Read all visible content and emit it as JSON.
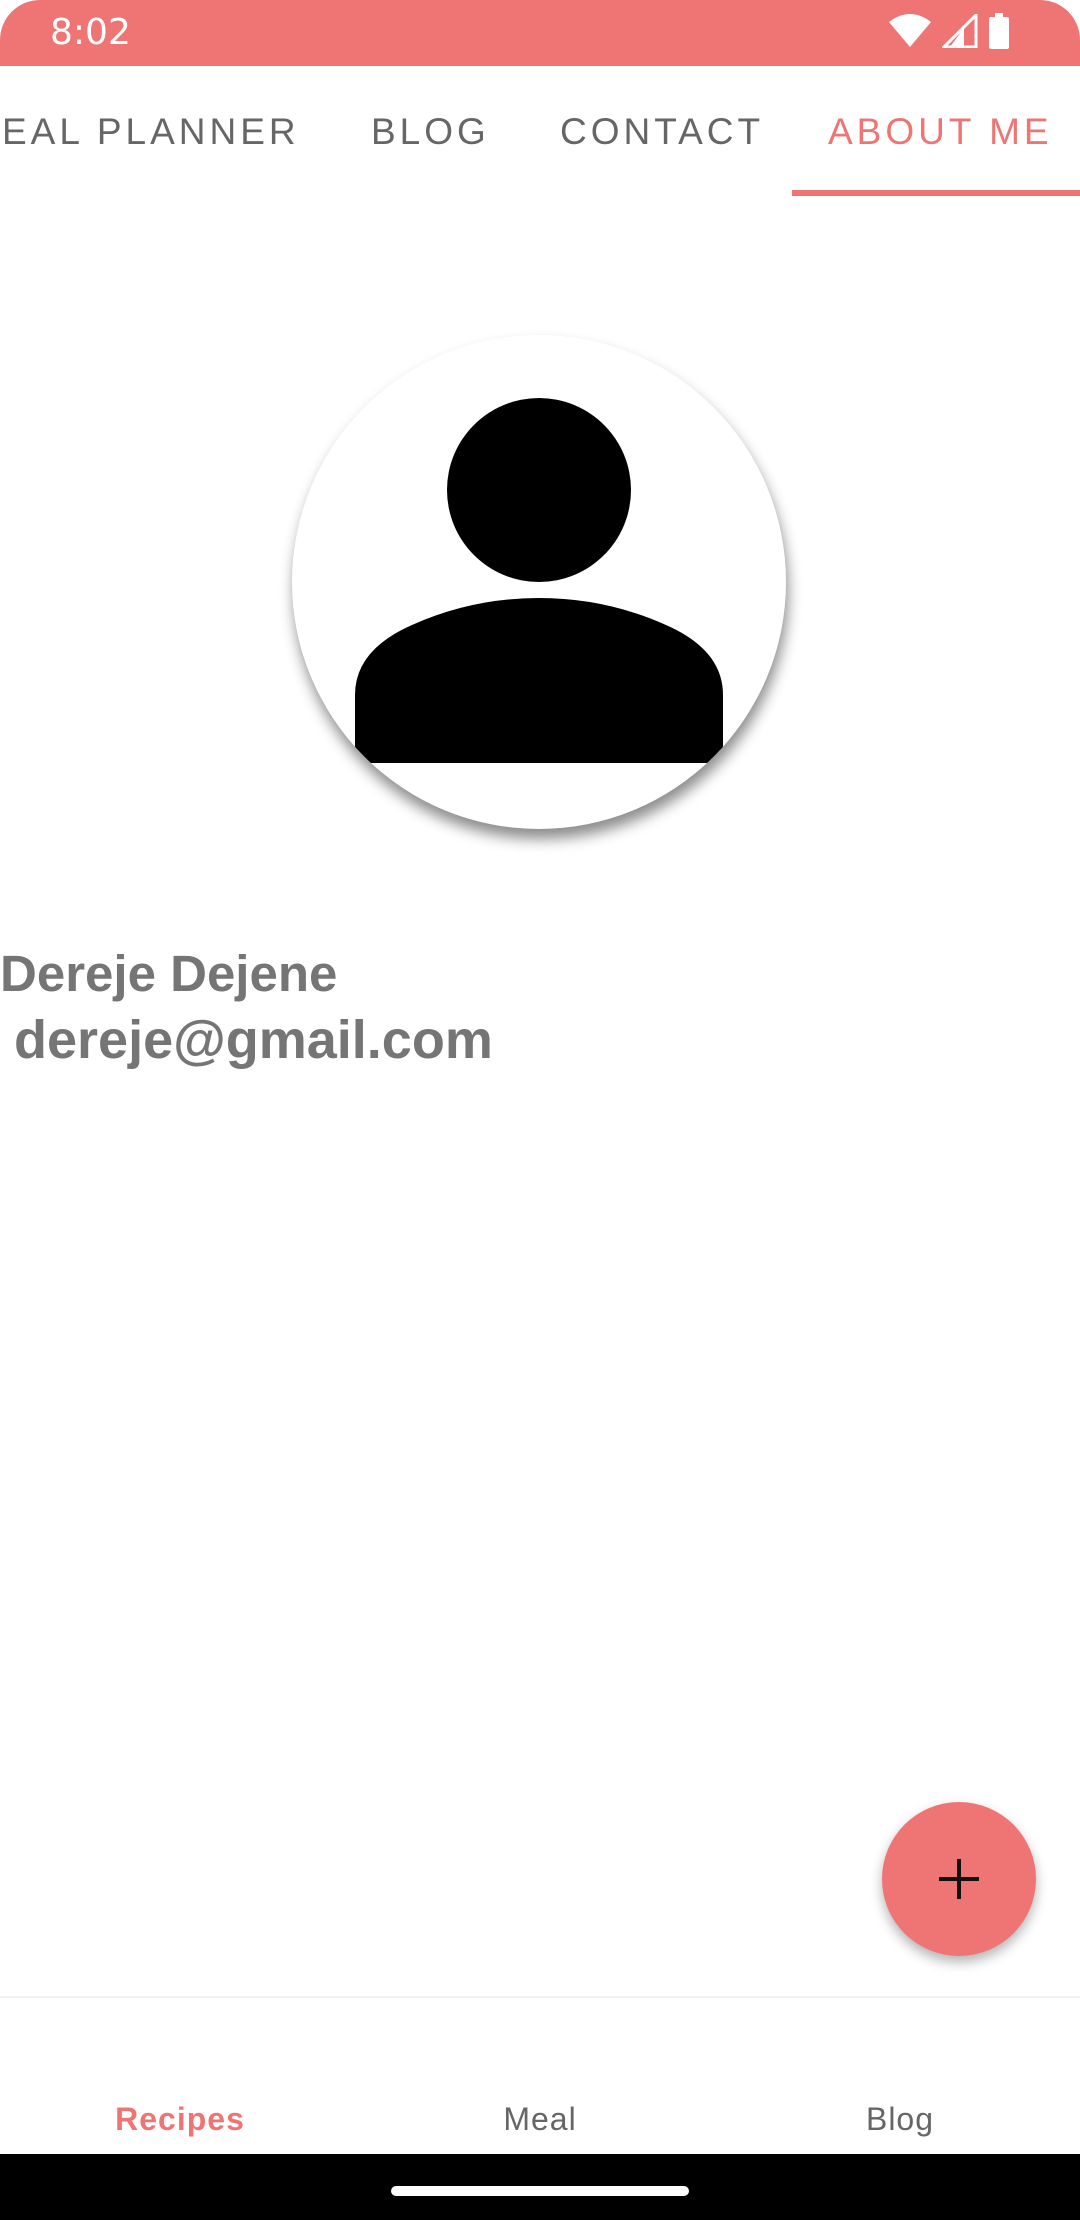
{
  "status_bar": {
    "time": "8:02",
    "icons": [
      "wifi-icon",
      "signal-icon",
      "battery-icon"
    ],
    "background": "#ef7575"
  },
  "top_tabs": {
    "items": [
      {
        "label": "EAL PLANNER",
        "active": false
      },
      {
        "label": "BLOG",
        "active": false
      },
      {
        "label": "CONTACT",
        "active": false
      },
      {
        "label": "ABOUT ME",
        "active": true
      }
    ]
  },
  "profile": {
    "avatar_icon": "person-icon",
    "name": "Dereje Dejene",
    "email": "dereje@gmail.com"
  },
  "fab": {
    "icon": "plus-icon"
  },
  "bottom_nav": {
    "items": [
      {
        "label": "Recipes",
        "active": true
      },
      {
        "label": "Meal",
        "active": false
      },
      {
        "label": "Blog",
        "active": false
      }
    ]
  },
  "colors": {
    "accent": "#ef7575",
    "text_secondary": "#757575",
    "tab_inactive": "#666666"
  }
}
